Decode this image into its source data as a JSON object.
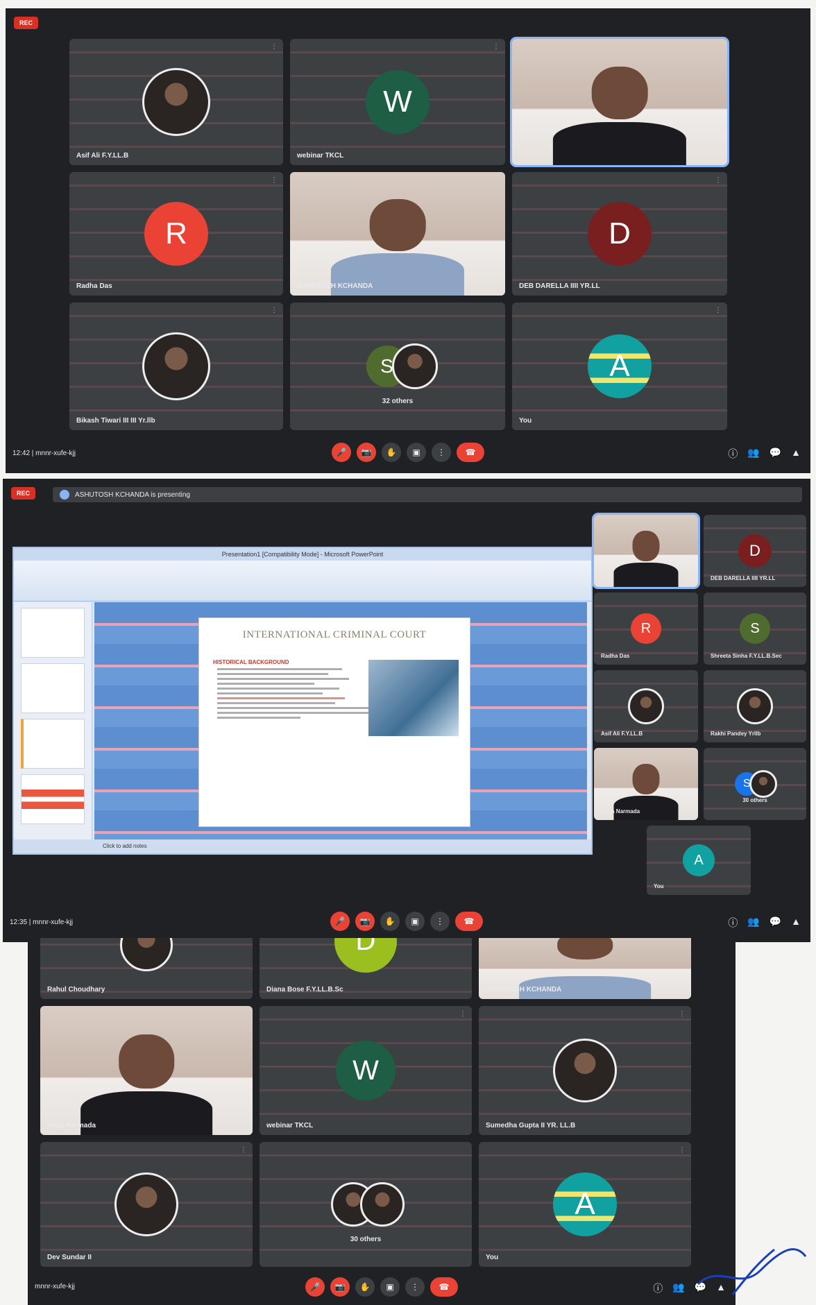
{
  "shot1": {
    "rec": "REC",
    "tiles": [
      {
        "name": "Asif Ali F.Y.LL.B",
        "kind": "photo"
      },
      {
        "name": "webinar TKCL",
        "kind": "avatar",
        "letter": "W",
        "color": "#1e5e44"
      },
      {
        "name": "",
        "kind": "video",
        "speaking": true
      },
      {
        "name": "Radha Das",
        "kind": "avatar",
        "letter": "R",
        "color": "#ea4335"
      },
      {
        "name": "ASHUTOSH KCHANDA",
        "kind": "video-blue"
      },
      {
        "name": "DEB DARELLA IIII YR.LL",
        "kind": "avatar",
        "letter": "D",
        "color": "#7a1f1f"
      },
      {
        "name": "Bikash Tiwari III III Yr.llb",
        "kind": "photo"
      },
      {
        "name": "32 others",
        "kind": "multi",
        "letter": "S",
        "color": "#4f6b2d"
      },
      {
        "name": "You",
        "kind": "avatar",
        "letter": "A",
        "color": "#12a1a1"
      }
    ],
    "bar": {
      "info": "12:42 | mnnr-xufe-kjj"
    }
  },
  "shot2": {
    "rec": "REC",
    "banner": "ASHUTOSH KCHANDA is presenting",
    "ppt": {
      "window_title": "Presentation1 [Compatibility Mode] - Microsoft PowerPoint",
      "slide_title": "INTERNATIONAL CRIMINAL COURT",
      "slide_heading": "HISTORICAL BACKGROUND",
      "status": "Click to add notes"
    },
    "tiles": [
      {
        "name": "",
        "kind": "video",
        "speaking": true
      },
      {
        "name": "DEB DARELLA IIII YR.LL",
        "kind": "avatar",
        "letter": "D",
        "color": "#7a1f1f"
      },
      {
        "name": "Radha Das",
        "kind": "avatar",
        "letter": "R",
        "color": "#ea4335"
      },
      {
        "name": "Shreeta Sinha F.Y.LL.B.Sec",
        "kind": "avatar",
        "letter": "S",
        "color": "#4f6b2d"
      },
      {
        "name": "Asif Ali F.Y.LL.B",
        "kind": "photo"
      },
      {
        "name": "Rakhi Pandey Yrllb",
        "kind": "photo"
      },
      {
        "name": "Priya Narmada",
        "kind": "video"
      },
      {
        "name": "30 others",
        "kind": "multi",
        "letter": "S",
        "color": "#1a73e8"
      },
      {
        "name": "You",
        "kind": "avatar",
        "letter": "A",
        "color": "#12a1a1"
      }
    ],
    "bar": {
      "info": "12:35 | mnnr-xufe-kjj"
    }
  },
  "shot3": {
    "tiles": [
      {
        "name": "Rahul Choudhary",
        "kind": "photo"
      },
      {
        "name": "Diana Bose F.Y.LL.B.Sc",
        "kind": "avatar",
        "letter": "D",
        "color": "#9bbf1f"
      },
      {
        "name": "ASHUTOSH KCHANDA",
        "kind": "video-blue"
      },
      {
        "name": "Priya Narmada",
        "kind": "video"
      },
      {
        "name": "webinar TKCL",
        "kind": "avatar",
        "letter": "W",
        "color": "#1e5e44"
      },
      {
        "name": "Sumedha Gupta II YR. LL.B",
        "kind": "photo"
      },
      {
        "name": "Dev Sundar II",
        "kind": "photo"
      },
      {
        "name": "30 others",
        "kind": "multi",
        "letter": "",
        "color": "#555"
      },
      {
        "name": "You",
        "kind": "avatar",
        "letter": "A",
        "color": "#12a1a1"
      }
    ],
    "bar": {
      "info": "mnnr-xufe-kjj"
    }
  },
  "controls": {
    "mic": "🎤",
    "cam": "📷",
    "hand": "✋",
    "present": "▣",
    "more": "⋮",
    "hangup": "☎",
    "info": "ⓘ",
    "people": "👥",
    "chat": "💬",
    "activities": "▲"
  }
}
